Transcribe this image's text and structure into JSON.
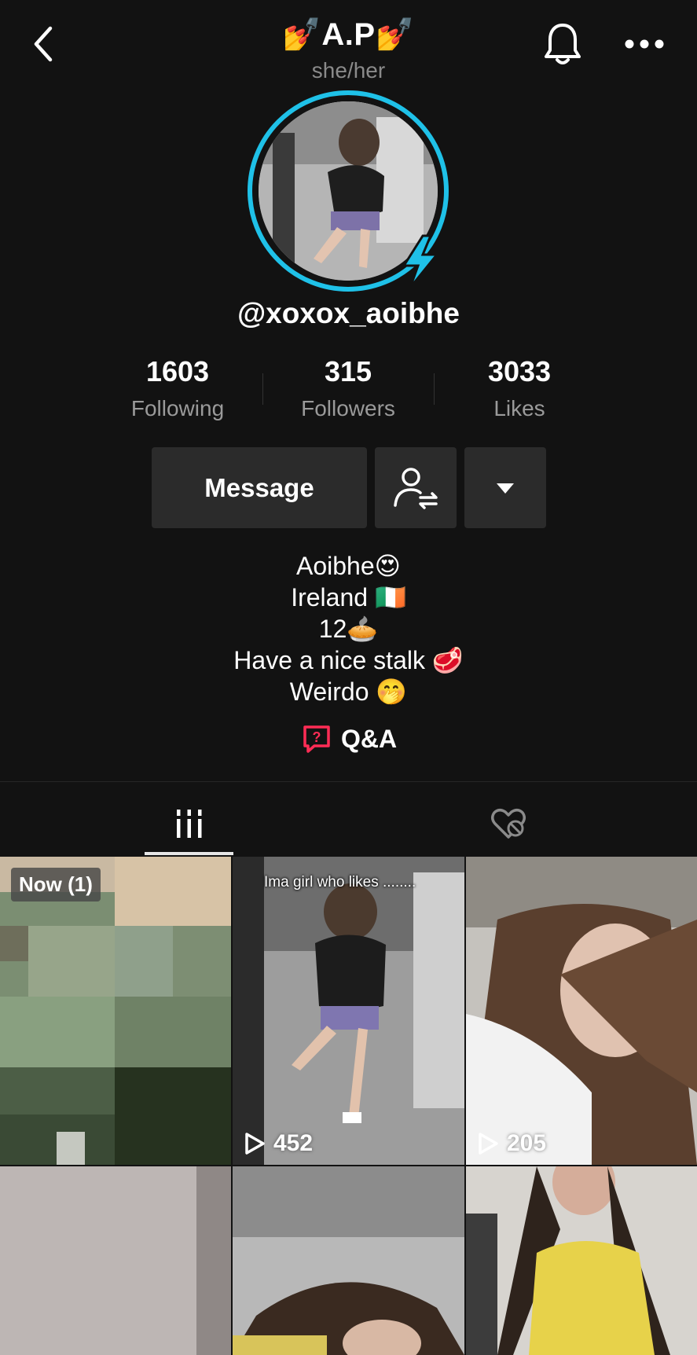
{
  "header": {
    "title": "💅A.P💅",
    "pronouns": "she/her",
    "back_icon": "back-chevron-icon",
    "bell_icon": "bell-icon",
    "more_icon": "more-dots-icon"
  },
  "profile": {
    "username": "@xoxox_aoibhe",
    "avatar_ring_color": "#1fc1e8"
  },
  "stats": [
    {
      "value": "1603",
      "label": "Following"
    },
    {
      "value": "315",
      "label": "Followers"
    },
    {
      "value": "3033",
      "label": "Likes"
    }
  ],
  "actions": {
    "message_label": "Message",
    "follow_icon": "friend-follow-icon",
    "dropdown_icon": "caret-down-icon"
  },
  "bio": {
    "lines": [
      "Aoibhe😍",
      "Ireland 🇮🇪",
      "12🥧",
      "Have a nice stalk 🥩",
      "Weirdo 🤭"
    ],
    "qa_label": "Q&A",
    "qa_color": "#fe2c55"
  },
  "tabs": [
    {
      "name": "videos",
      "icon": "grid-bars-icon",
      "selected": true
    },
    {
      "name": "liked",
      "icon": "hidden-heart-icon",
      "selected": false
    }
  ],
  "grid": {
    "tiles": [
      {
        "badge": "Now (1)"
      },
      {
        "caption": "Ima girl who likes ........",
        "views": "452"
      },
      {
        "views": "205"
      },
      {},
      {},
      {}
    ]
  }
}
